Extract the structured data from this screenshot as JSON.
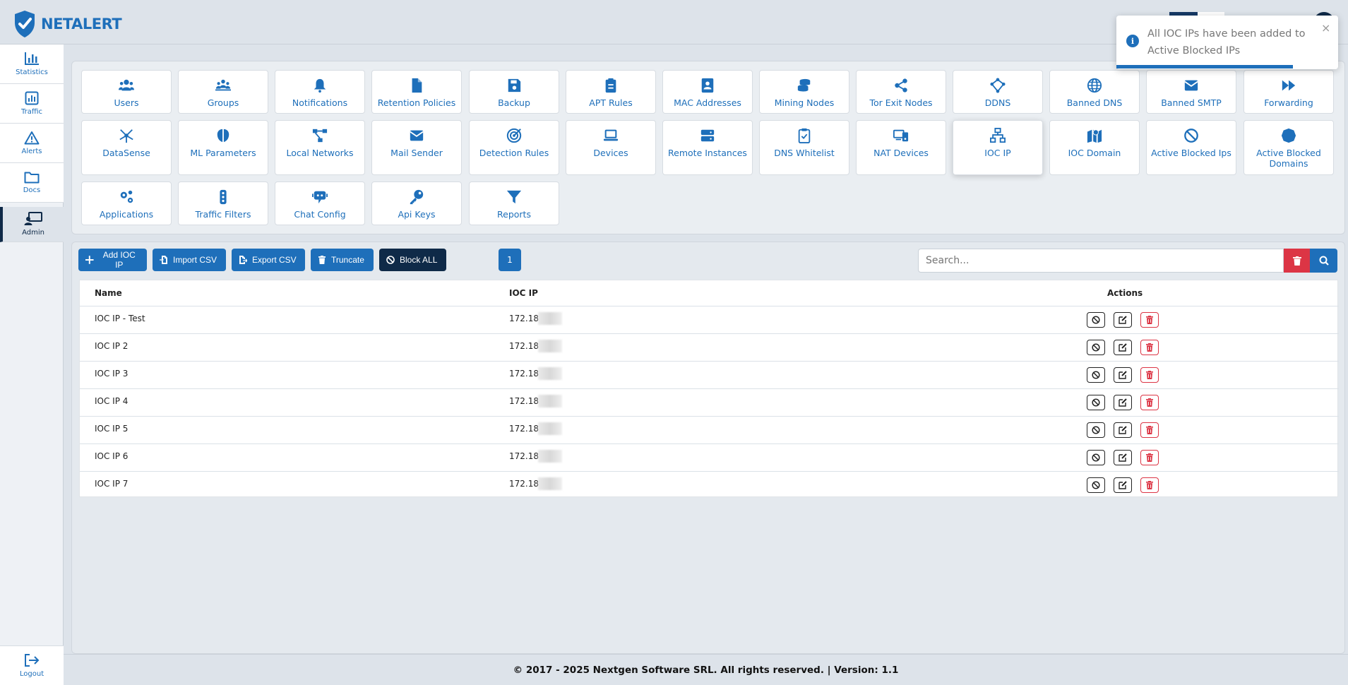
{
  "brand": {
    "name": "NETALERT"
  },
  "sidebar": {
    "items": [
      {
        "label": "Statistics",
        "icon": "chart-bar-icon"
      },
      {
        "label": "Traffic",
        "icon": "traffic-chart-icon"
      },
      {
        "label": "Alerts",
        "icon": "warning-icon"
      },
      {
        "label": "Docs",
        "icon": "folder-icon"
      },
      {
        "label": "Admin",
        "icon": "admin-icon",
        "active": true
      }
    ],
    "logout": {
      "label": "Logout",
      "icon": "logout-icon"
    }
  },
  "tiles": [
    {
      "label": "Users",
      "icon": "users-icon"
    },
    {
      "label": "Groups",
      "icon": "groups-icon"
    },
    {
      "label": "Notifications",
      "icon": "bell-icon"
    },
    {
      "label": "Retention Policies",
      "icon": "file-icon"
    },
    {
      "label": "Backup",
      "icon": "save-icon"
    },
    {
      "label": "APT Rules",
      "icon": "clipboard-icon"
    },
    {
      "label": "MAC Addresses",
      "icon": "address-book-icon"
    },
    {
      "label": "Mining Nodes",
      "icon": "coins-icon"
    },
    {
      "label": "Tor Exit Nodes",
      "icon": "share-icon"
    },
    {
      "label": "DDNS",
      "icon": "network-icon"
    },
    {
      "label": "Banned DNS",
      "icon": "globe-icon"
    },
    {
      "label": "Banned SMTP",
      "icon": "envelope-icon"
    },
    {
      "label": "Forwarding",
      "icon": "forward-icon"
    },
    {
      "label": "DataSense",
      "icon": "datasense-icon"
    },
    {
      "label": "ML Parameters",
      "icon": "brain-icon"
    },
    {
      "label": "Local Networks",
      "icon": "diagram-icon"
    },
    {
      "label": "Mail Sender",
      "icon": "envelope-icon"
    },
    {
      "label": "Detection Rules",
      "icon": "target-icon"
    },
    {
      "label": "Devices",
      "icon": "laptop-icon"
    },
    {
      "label": "Remote Instances",
      "icon": "server-icon"
    },
    {
      "label": "DNS Whitelist",
      "icon": "clipboard-check-icon"
    },
    {
      "label": "NAT Devices",
      "icon": "devices-icon"
    },
    {
      "label": "IOC IP",
      "icon": "sitemap-icon",
      "selected": true
    },
    {
      "label": "IOC Domain",
      "icon": "map-icon"
    },
    {
      "label": "Active Blocked Ips",
      "icon": "ban-icon"
    },
    {
      "label": "Active Blocked Domains",
      "icon": "circle-icon"
    },
    {
      "label": "Applications",
      "icon": "cogs-icon"
    },
    {
      "label": "Traffic Filters",
      "icon": "traffic-light-icon"
    },
    {
      "label": "Chat Config",
      "icon": "chat-bot-icon"
    },
    {
      "label": "Api Keys",
      "icon": "key-icon"
    },
    {
      "label": "Reports",
      "icon": "filter-icon"
    }
  ],
  "toolbar": {
    "add_label": "Add IOC IP",
    "import_label": "Import CSV",
    "export_label": "Export CSV",
    "truncate_label": "Truncate",
    "block_all_label": "Block ALL",
    "page": "1",
    "search_placeholder": "Search..."
  },
  "table": {
    "headers": {
      "name": "Name",
      "ioc_ip": "IOC IP",
      "actions": "Actions"
    },
    "rows": [
      {
        "name": "IOC IP - Test",
        "ip": "172.18"
      },
      {
        "name": "IOC IP 2",
        "ip": "172.18"
      },
      {
        "name": "IOC IP 3",
        "ip": "172.18"
      },
      {
        "name": "IOC IP 4",
        "ip": "172.18"
      },
      {
        "name": "IOC IP 5",
        "ip": "172.18"
      },
      {
        "name": "IOC IP 6",
        "ip": "172.18"
      },
      {
        "name": "IOC IP 7",
        "ip": "172.18"
      }
    ]
  },
  "footer": {
    "text": "© 2017 - 2025 Nextgen Software SRL. All rights reserved. | Version: 1.1"
  },
  "toast": {
    "message": "All IOC IPs have been added to Active Blocked IPs",
    "info_glyph": "i",
    "close_glyph": "×"
  },
  "colors": {
    "primary": "#1e6fba",
    "dark": "#0f2a48",
    "danger": "#dc3545",
    "background": "#dde3ea"
  }
}
